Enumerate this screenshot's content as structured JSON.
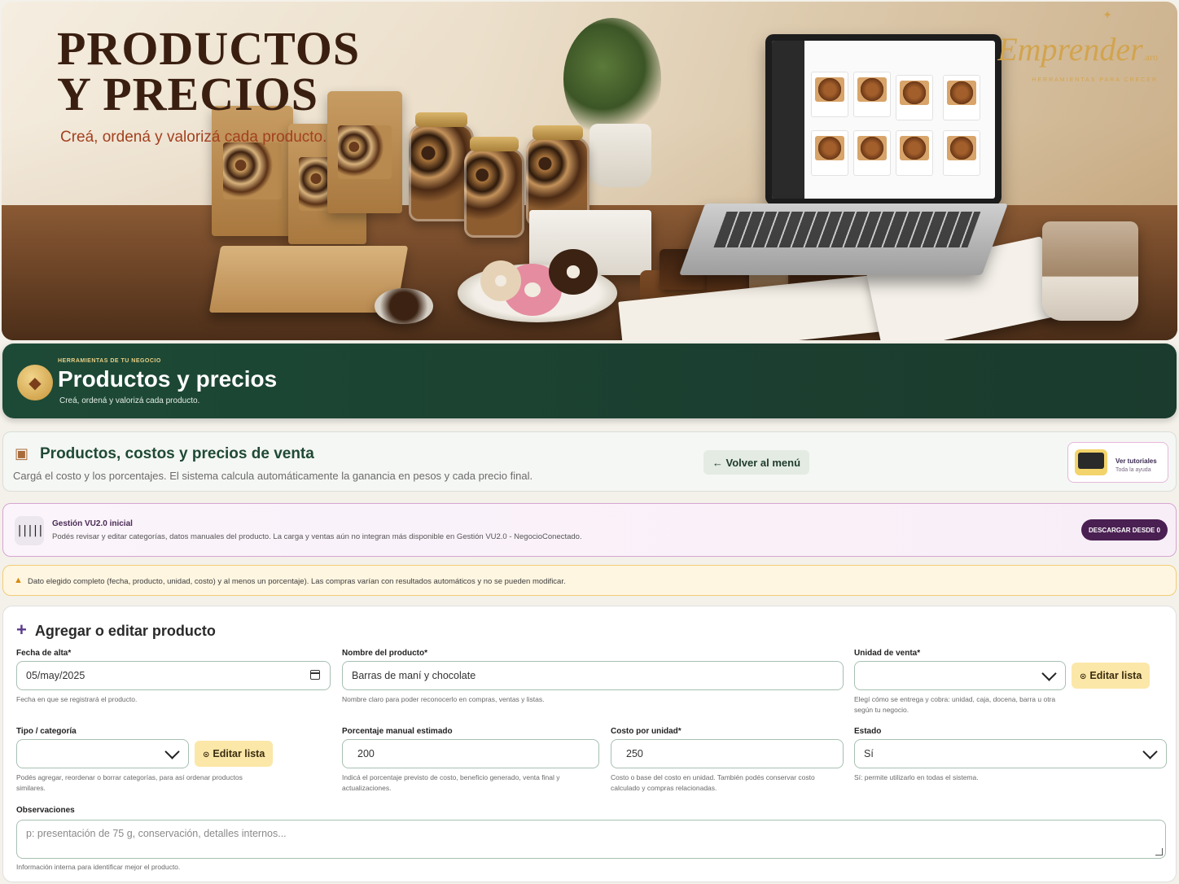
{
  "hero": {
    "title_line1": "PRODUCTOS",
    "title_line2": "Y PRECIOS",
    "subtitle": "Creá, ordená y valorizá cada producto.",
    "brand_name": "Emprender",
    "brand_suffix": ".aro",
    "brand_tagline": "HERRAMIENTAS PARA CRECER"
  },
  "header": {
    "kicker": "HERRAMIENTAS DE TU NEGOCIO",
    "title": "Productos y precios",
    "subtitle": "Creá, ordená y valorizá cada producto."
  },
  "section": {
    "title": "Productos, costos y precios de venta",
    "description": "Cargá el costo y los porcentajes. El sistema calcula automáticamente la ganancia en pesos y cada precio final.",
    "back_button": "← Volver al menú",
    "tutorials_title": "Ver tutoriales",
    "tutorials_sub": "Toda la ayuda"
  },
  "banner": {
    "title": "Gestión VU2.0 inicial",
    "text": "Podés revisar y editar categorías, datos manuales del producto. La carga y ventas aún no integran más disponible en Gestión VU2.0 - NegocioConectado.",
    "button": "DESCARGAR DESDE 0"
  },
  "warning": {
    "text": "Dato elegido completo (fecha, producto, unidad, costo) y al menos un porcentaje). Las compras varían con resultados automáticos y no se pueden modificar."
  },
  "form": {
    "title": "Agregar o editar producto",
    "fecha": {
      "label": "Fecha de alta*",
      "value": "05/may/2025",
      "help": "Fecha en que se registrará el producto."
    },
    "nombre": {
      "label": "Nombre del producto*",
      "value": "Barras de maní y chocolate",
      "help": "Nombre claro para poder reconocerlo en compras, ventas y listas."
    },
    "unidad": {
      "label": "Unidad de venta*",
      "value": "",
      "edit_button": "Editar lista",
      "help_line1": "Elegí cómo se entrega y cobra: unidad, caja, docena, barra u otra",
      "help_line2": "según tu negocio."
    },
    "tipo": {
      "label": "Tipo / categoría",
      "value": "",
      "edit_button": "Editar lista",
      "help_line1": "Podés agregar, reordenar o borrar categorías, para así ordenar productos",
      "help_line2": "similares."
    },
    "porcentaje": {
      "label": "Porcentaje manual estimado",
      "value": "200",
      "help_line1": "Indicá el porcentaje previsto de costo, beneficio generado, venta final y",
      "help_line2": "actualizaciones."
    },
    "costo": {
      "label": "Costo por unidad*",
      "value": "250",
      "help_line1": "Costo o base del costo en unidad. También podés conservar costo",
      "help_line2": "calculado y compras relacionadas."
    },
    "estado": {
      "label": "Estado",
      "value": "Sí",
      "help": "Sí: permite utilizarlo en todas el sistema."
    },
    "observaciones": {
      "label": "Observaciones",
      "placeholder": "p: presentación de 75 g, conservación, detalles internos...",
      "help": "Información interna para identificar mejor el producto."
    }
  }
}
